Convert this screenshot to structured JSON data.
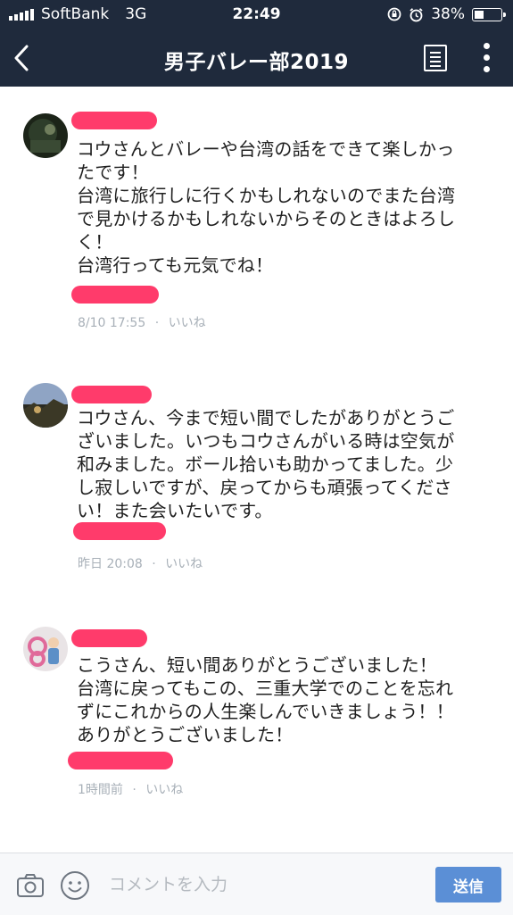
{
  "status_bar": {
    "carrier": "SoftBank",
    "network": "3G",
    "time": "22:49",
    "battery": "38%",
    "battery_level": 0.38
  },
  "header": {
    "title": "男子バレー部2019",
    "back_icon": "chevron-left-icon",
    "menu_icon": "list-icon",
    "more_icon": "more-vertical-icon",
    "background": "#1f2a3c"
  },
  "comments": [
    {
      "lines": [
        "コウさんとバレーや台湾の話をできて楽しかっ",
        "たです！",
        "台湾に旅行しに行くかもしれないのでまた台湾",
        "で見かけるかもしれないからそのときはよろし",
        "く！",
        "台湾行っても元気でね！"
      ],
      "timestamp": "8/10 17:55",
      "separator": "·",
      "like_label": "いいね"
    },
    {
      "lines": [
        "コウさん、今まで短い間でしたがありがとうご",
        "ざいました。いつもコウさんがいる時は空気が",
        "和みました。ボール拾いも助かってました。少",
        "し寂しいですが、戻ってからも頑張ってくださ",
        "い！また会いたいです。"
      ],
      "timestamp": "昨日 20:08",
      "separator": "·",
      "like_label": "いいね"
    },
    {
      "lines": [
        "こうさん、短い間ありがとうございました！",
        "台湾に戻ってもこの、三重大学でのことを忘れ",
        "ずにこれからの人生楽しんでいきましょう！！",
        "ありがとうございました！"
      ],
      "timestamp": "1時間前",
      "separator": "·",
      "like_label": "いいね"
    }
  ],
  "input_bar": {
    "placeholder": "コメントを入力",
    "send_label": "送信",
    "camera_icon": "camera-icon",
    "emoji_icon": "emoji-icon",
    "accent": "#5b8fd6"
  },
  "redaction_color": "#ff3b6b"
}
